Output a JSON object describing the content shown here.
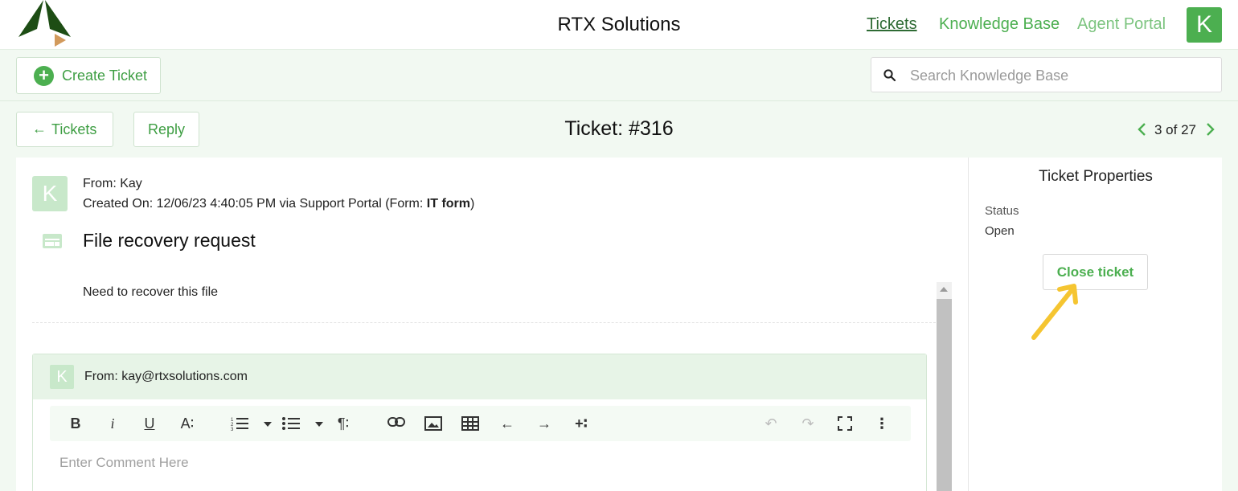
{
  "header": {
    "app_title": "RTX Solutions",
    "nav": [
      {
        "label": "Tickets",
        "active": true
      },
      {
        "label": "Knowledge Base",
        "active": false
      },
      {
        "label": "Agent Portal",
        "active": false
      }
    ],
    "user_initial": "K"
  },
  "toolbar": {
    "create_label": "Create Ticket",
    "search_placeholder": "Search Knowledge Base"
  },
  "ticket_nav": {
    "back_label": "Tickets",
    "reply_label": "Reply",
    "title": "Ticket: #316",
    "pager": "3 of 27"
  },
  "message": {
    "avatar_initial": "K",
    "from": "From: Kay",
    "created_prefix": "Created On: 12/06/23 4:40:05 PM via Support Portal (Form: ",
    "form_name": "IT form",
    "created_suffix": ")",
    "subject": "File recovery request",
    "body": "Need to recover this file"
  },
  "reply": {
    "avatar_initial": "K",
    "from": "From: kay@rtxsolutions.com",
    "editor_tools": [
      "bold",
      "italic",
      "underline",
      "font-size",
      "ordered-list",
      "unordered-list",
      "paragraph-format",
      "link",
      "image",
      "table",
      "outdent",
      "indent",
      "insert-more",
      "undo",
      "redo",
      "fullscreen",
      "more"
    ],
    "comment_placeholder": "Enter Comment Here"
  },
  "sidebar": {
    "title": "Ticket Properties",
    "status_label": "Status",
    "status_value": "Open",
    "close_label": "Close ticket"
  },
  "colors": {
    "brand_green": "#4caf50",
    "dark_green": "#2e6b34",
    "light_green_bg": "#f2f9f2",
    "annotation_yellow": "#f5c531"
  }
}
